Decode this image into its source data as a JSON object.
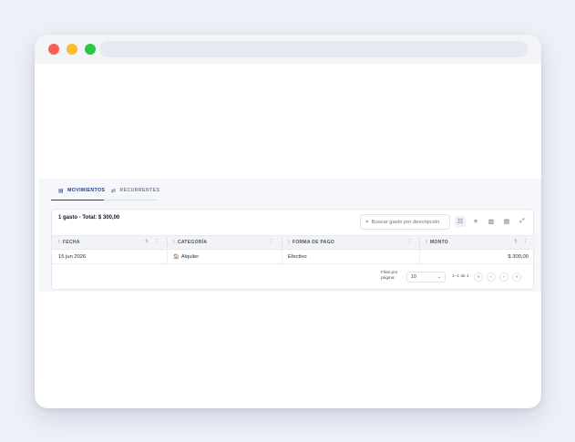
{
  "tabs": [
    {
      "label": "MOVIMIENTOS",
      "icon": "receipt-icon",
      "active": true
    },
    {
      "label": "RECURRENTES",
      "icon": "repeat-icon",
      "active": false
    }
  ],
  "summary": "1 gasto - Total: $ 300,00",
  "search": {
    "placeholder": "Buscar gasto por descripción"
  },
  "toolbar": {
    "icons": [
      "columns-icon",
      "filter-icon",
      "density-icon",
      "export-icon",
      "fullscreen-icon"
    ]
  },
  "table": {
    "columns": [
      "FECHA",
      "CATEGORÍA",
      "FORMA DE PAGO",
      "MONTO"
    ],
    "rows": [
      {
        "fecha": "15 jun 2026",
        "categoria_icon": "🏠",
        "categoria": "Alquiler",
        "forma_pago": "Efectivo",
        "monto": "$ 300,00"
      }
    ]
  },
  "pagination": {
    "rows_per_page_label": "Filas por página:",
    "rows_per_page": "10",
    "range": "1–1 de 1"
  }
}
